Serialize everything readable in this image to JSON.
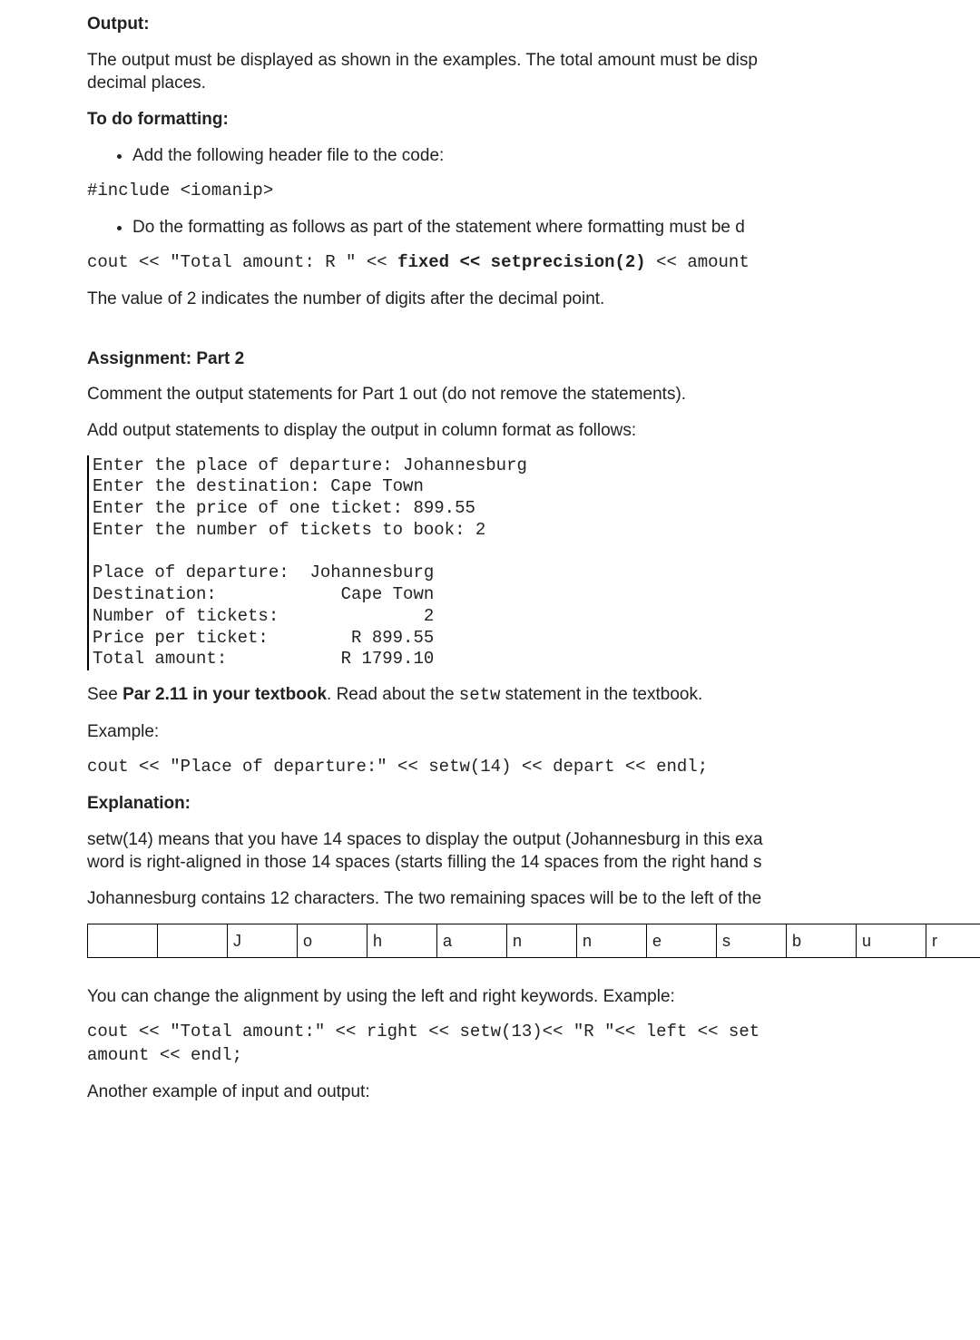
{
  "h_output": "Output:",
  "p_output": "The output must be displayed as shown in the examples. The total amount must be disp",
  "p_output_cont": "decimal places.",
  "h_todo": "To do formatting:",
  "b1": "Add the following header file to the code:",
  "code_include": "#include <iomanip>",
  "b2": "Do the formatting as follows as part of the statement where formatting must be d",
  "code_cout_fixed_pre": "cout << \"Total amount: R \" << ",
  "code_cout_fixed_bold": "fixed << setprecision(2)",
  "code_cout_fixed_post": " << amount",
  "p_value2": "The value of 2 indicates the number of digits after the decimal point.",
  "h_part2": "Assignment: Part 2",
  "p_part2_1": "Comment the output statements for Part 1 out (do not remove the statements).",
  "p_part2_2": "Add output statements to display the output in column format as follows:",
  "console_block": "Enter the place of departure: Johannesburg\nEnter the destination: Cape Town\nEnter the price of one ticket: 899.55\nEnter the number of tickets to book: 2\n\nPlace of departure:  Johannesburg\nDestination:            Cape Town\nNumber of tickets:              2\nPrice per ticket:        R 899.55\nTotal amount:           R 1799.10",
  "p_see_pre": "See ",
  "p_see_bold": "Par 2.11 in your textbook",
  "p_see_mid": ". Read about the ",
  "p_see_code": "setw",
  "p_see_post": " statement in the textbook.",
  "p_example": "Example:",
  "code_setw_example": "cout << \"Place of departure:\" << setw(14) << depart << endl;",
  "h_expl": "Explanation:",
  "p_expl1": "setw(14) means that you have 14 spaces to display the output (Johannesburg in this exa",
  "p_expl1b": "word is right-aligned in those 14 spaces (starts filling the 14 spaces from the right hand s",
  "p_expl2": "Johannesburg contains 12 characters. The two remaining spaces will be to the left of the",
  "letters": [
    "",
    "",
    "J",
    "o",
    "h",
    "a",
    "n",
    "n",
    "e",
    "s",
    "b",
    "u",
    "r"
  ],
  "p_align": "You can change the alignment by using the left and right keywords. Example:",
  "code_align": "cout << \"Total amount:\" << right << setw(13)<< \"R \"<< left << set",
  "code_align2": "amount << endl;",
  "p_another": "Another example of input and output:"
}
